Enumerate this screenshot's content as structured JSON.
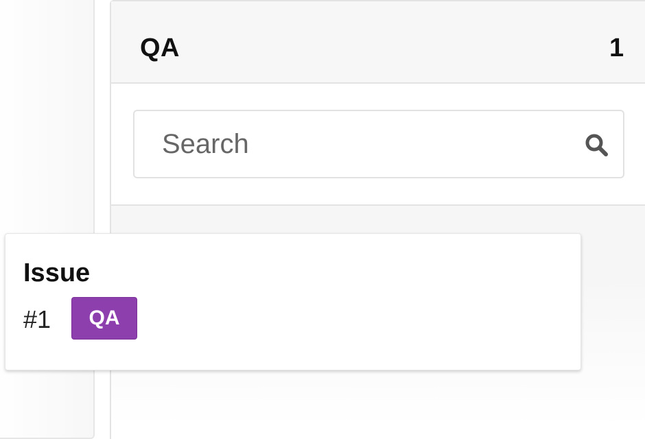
{
  "column": {
    "title": "QA",
    "issue_count": "1"
  },
  "search": {
    "placeholder": "Search",
    "value": ""
  },
  "card": {
    "title": "Issue",
    "number": "#1",
    "label": "QA",
    "label_color": "#8e3fae"
  },
  "icons": {
    "search": "search-icon"
  }
}
